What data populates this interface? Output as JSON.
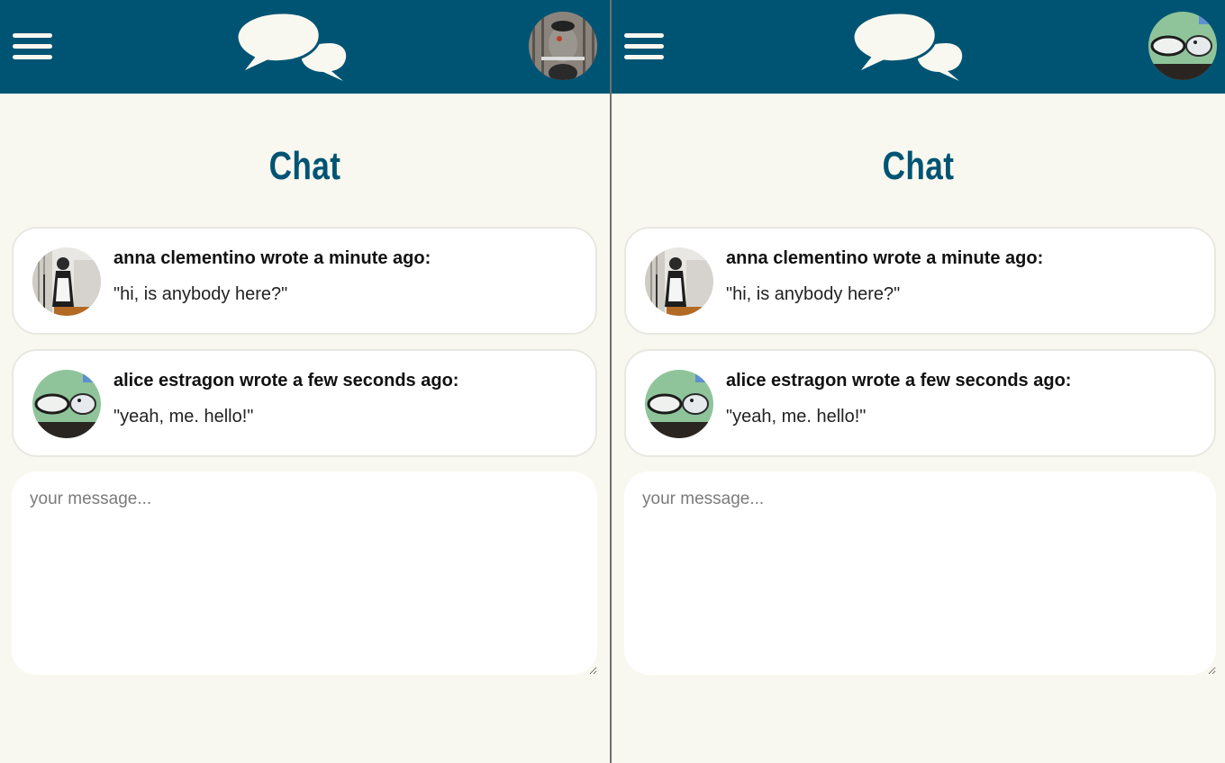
{
  "colors": {
    "header_bg": "#005473",
    "page_bg": "#f9f8f0",
    "title": "#005473",
    "card_bg": "#ffffff",
    "card_border": "#e8e8e2"
  },
  "icons": {
    "menu": "hamburger-menu-icon",
    "logo": "chat-bubbles-icon"
  },
  "panes": [
    {
      "user": "rat-avatar",
      "title": "Chat",
      "messages": [
        {
          "meta": "anna clementino wrote a minute ago:",
          "text": "\"hi, is anybody here?\""
        },
        {
          "meta": "alice estragon wrote a few seconds ago:",
          "text": "\"yeah, me. hello!\""
        }
      ],
      "composer": {
        "placeholder": "your message...",
        "value": ""
      }
    },
    {
      "user": "graffiti-avatar",
      "title": "Chat",
      "messages": [
        {
          "meta": "anna clementino wrote a minute ago:",
          "text": "\"hi, is anybody here?\""
        },
        {
          "meta": "alice estragon wrote a few seconds ago:",
          "text": "\"yeah, me. hello!\""
        }
      ],
      "composer": {
        "placeholder": "your message...",
        "value": ""
      }
    }
  ]
}
